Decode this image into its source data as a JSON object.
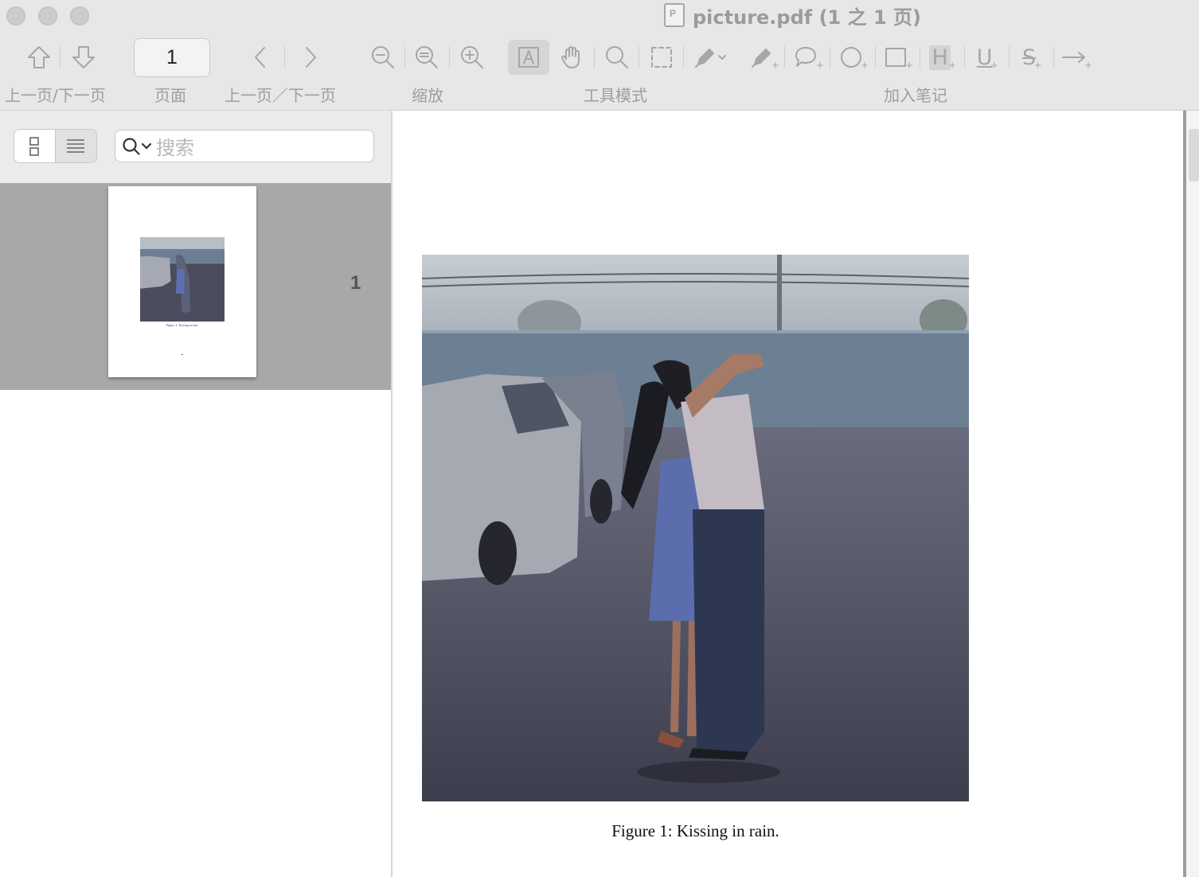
{
  "window": {
    "title": "picture.pdf (1 之 1 页)"
  },
  "toolbar": {
    "page_value": "1",
    "labels": {
      "prev_next_page": "上一页/下一页",
      "page": "页面",
      "prev_next": "上一页／下一页",
      "zoom": "缩放",
      "tool_mode": "工具模式",
      "add_note": "加入笔记"
    },
    "annot_glyphs": {
      "highlight": "H",
      "underline": "U",
      "strike": "S",
      "plus": "+"
    }
  },
  "sidebar": {
    "search_placeholder": "搜索",
    "thumbnails": [
      {
        "page_number": "1",
        "caption": "Figure 1: Kissing in rain."
      }
    ]
  },
  "document": {
    "figure_caption": "Figure 1: Kissing in rain."
  },
  "colors": {
    "toolbar_bg": "#e8e7e8",
    "icon_gray": "#a6a6a6",
    "thumb_row_bg": "#a8a8a8",
    "photo_sky": "#b9c0c7",
    "photo_wall": "#6d8196",
    "photo_ground": "#4a4b5c"
  }
}
